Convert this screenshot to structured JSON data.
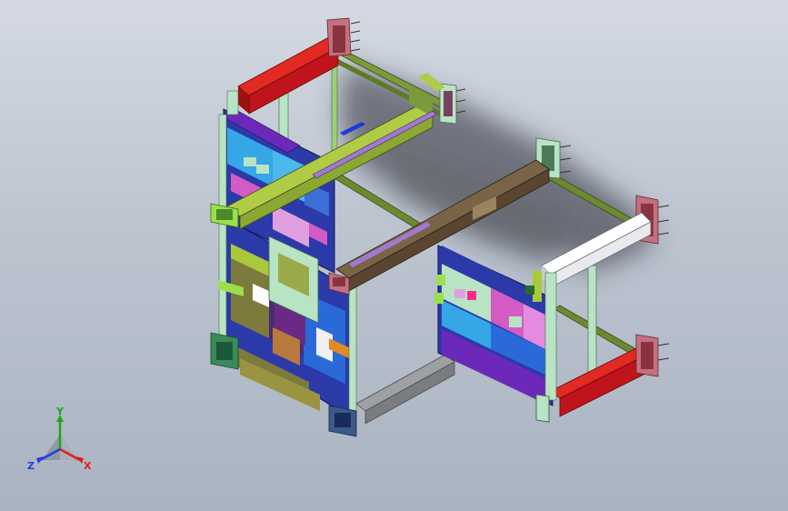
{
  "triad": {
    "x_label": "X",
    "y_label": "Y",
    "z_label": "Z",
    "x_color": "#e0201c",
    "y_color": "#18a818",
    "z_color": "#2040e0"
  },
  "scene": {
    "background_top": "#d4d9e2",
    "background_bottom": "#aab3c1",
    "colors": {
      "frame_blue": "#2b3aa8",
      "rail_green": "#7a9a3c",
      "lime": "#a9c93a",
      "beam_brown": "#6b5840",
      "red_rail": "#c0141c",
      "white_rail": "#f2f4f6",
      "magenta": "#d25cc4",
      "cyan": "#35a6e6",
      "mint": "#b8e4c4",
      "olive": "#7c7a3c",
      "grey_bar": "#8e9094",
      "purple": "#6c28b8",
      "pink_plate": "#c47080"
    }
  }
}
